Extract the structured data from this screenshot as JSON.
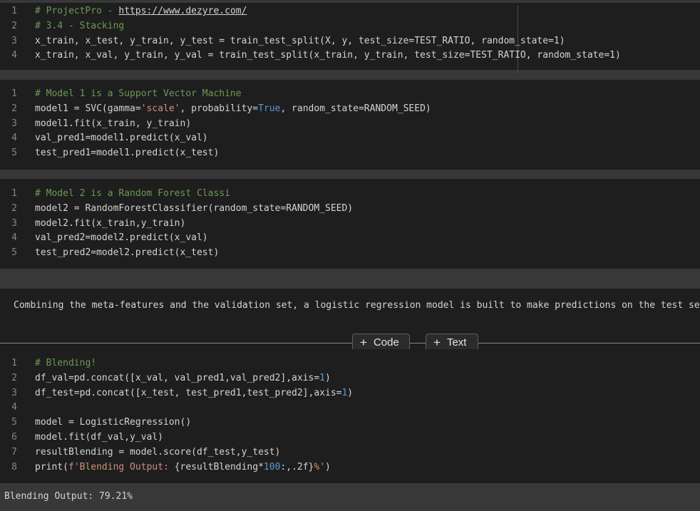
{
  "cells": [
    {
      "id": "cell1",
      "lines": [
        {
          "n": "1",
          "parts": [
            {
              "t": "# ProjectPro - ",
              "c": "c"
            },
            {
              "t": "https://www.dezyre.com/",
              "c": "lnk"
            }
          ]
        },
        {
          "n": "2",
          "parts": [
            {
              "t": "# 3.4 - Stacking",
              "c": "c"
            }
          ]
        },
        {
          "n": "3",
          "parts": [
            {
              "t": "x_train, x_test, y_train, y_test = train_test_split(X, y, test_size=TEST_RATIO, random_state=1)",
              "c": ""
            }
          ]
        },
        {
          "n": "4",
          "parts": [
            {
              "t": "x_train, x_val, y_train, y_val = train_test_split(x_train, y_train, test_size=TEST_RATIO, random_state=1)",
              "c": ""
            }
          ]
        }
      ]
    },
    {
      "id": "cell2",
      "lines": [
        {
          "n": "1",
          "parts": [
            {
              "t": "# Model 1 is a Support Vector Machine",
              "c": "c"
            }
          ]
        },
        {
          "n": "2",
          "parts": [
            {
              "t": "model1 = SVC(gamma=",
              "c": ""
            },
            {
              "t": "'scale'",
              "c": "s"
            },
            {
              "t": ", probability=",
              "c": ""
            },
            {
              "t": "True",
              "c": "k"
            },
            {
              "t": ", random_state=RANDOM_SEED)",
              "c": ""
            }
          ]
        },
        {
          "n": "3",
          "parts": [
            {
              "t": "model1.fit(x_train, y_train)",
              "c": ""
            }
          ]
        },
        {
          "n": "4",
          "parts": [
            {
              "t": "val_pred1=model1.predict(x_val)",
              "c": ""
            }
          ]
        },
        {
          "n": "5",
          "parts": [
            {
              "t": "test_pred1=model1.predict(x_test)",
              "c": ""
            }
          ]
        }
      ]
    },
    {
      "id": "cell3",
      "lines": [
        {
          "n": "1",
          "parts": [
            {
              "t": "# Model 2 is a Random Forest Classi",
              "c": "c"
            }
          ]
        },
        {
          "n": "2",
          "parts": [
            {
              "t": "model2 = RandomForestClassifier(random_state=RANDOM_SEED)",
              "c": ""
            }
          ]
        },
        {
          "n": "3",
          "parts": [
            {
              "t": "model2.fit(x_train,y_train)",
              "c": ""
            }
          ]
        },
        {
          "n": "4",
          "parts": [
            {
              "t": "val_pred2=model2.predict(x_val)",
              "c": ""
            }
          ]
        },
        {
          "n": "5",
          "parts": [
            {
              "t": "test_pred2=model2.predict(x_test)",
              "c": ""
            }
          ]
        }
      ]
    },
    {
      "id": "cell4",
      "lines": [
        {
          "n": "1",
          "parts": [
            {
              "t": "# Blending!",
              "c": "c"
            }
          ]
        },
        {
          "n": "2",
          "parts": [
            {
              "t": "df_val=pd.concat([x_val, val_pred1,val_pred2],axis=",
              "c": ""
            },
            {
              "t": "1",
              "c": "k"
            },
            {
              "t": ")",
              "c": ""
            }
          ]
        },
        {
          "n": "3",
          "parts": [
            {
              "t": "df_test=pd.concat([x_test, test_pred1,test_pred2],axis=",
              "c": ""
            },
            {
              "t": "1",
              "c": "k"
            },
            {
              "t": ")",
              "c": ""
            }
          ]
        },
        {
          "n": "4",
          "parts": [
            {
              "t": "",
              "c": ""
            }
          ]
        },
        {
          "n": "5",
          "parts": [
            {
              "t": "model = LogisticRegression()",
              "c": ""
            }
          ]
        },
        {
          "n": "6",
          "parts": [
            {
              "t": "model.fit(df_val,y_val)",
              "c": ""
            }
          ]
        },
        {
          "n": "7",
          "parts": [
            {
              "t": "resultBlending = model.score(df_test,y_test)",
              "c": ""
            }
          ]
        },
        {
          "n": "8",
          "parts": [
            {
              "t": "print(",
              "c": ""
            },
            {
              "t": "f'Blending Output: ",
              "c": "s"
            },
            {
              "t": "{resultBlending*",
              "c": ""
            },
            {
              "t": "100",
              "c": "k"
            },
            {
              "t": ":,.2f}",
              "c": ""
            },
            {
              "t": "%'",
              "c": "s"
            },
            {
              "t": ")",
              "c": ""
            }
          ]
        }
      ]
    }
  ],
  "text_cell": {
    "content": "Combining the meta-features and the validation set, a logistic regression model is built to make predictions on the test set."
  },
  "toolbar": {
    "plus_icon": "+",
    "code_label": "Code",
    "text_label": "Text"
  },
  "output": {
    "text": "Blending Output: 79.21%"
  }
}
